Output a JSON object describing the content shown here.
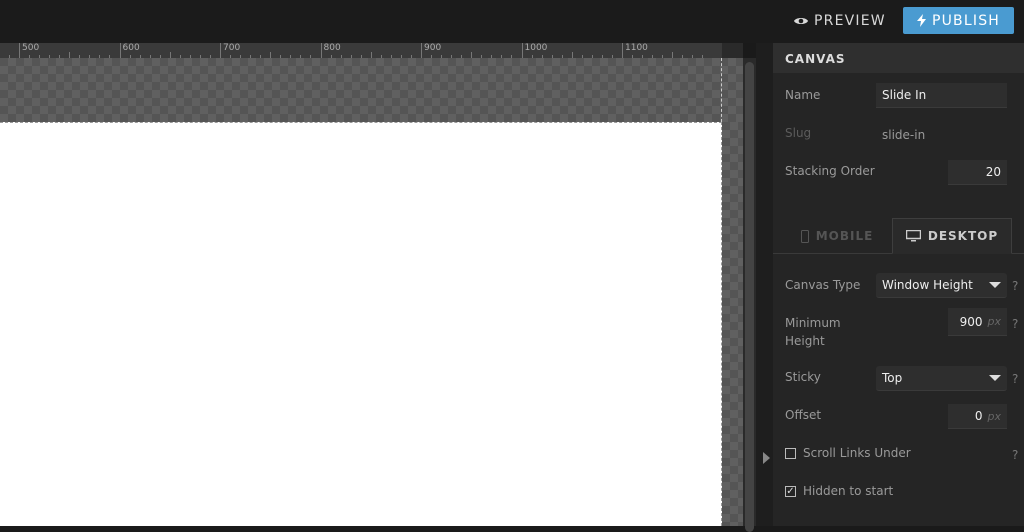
{
  "topbar": {
    "preview_label": "PREVIEW",
    "publish_label": "PUBLISH",
    "accent": "#4a9bd1"
  },
  "ruler": {
    "labels": [
      "500",
      "600",
      "700",
      "800",
      "900",
      "1000",
      "1100"
    ]
  },
  "panel": {
    "title": "CANVAS",
    "name_label": "Name",
    "name_value": "Slide In",
    "slug_label": "Slug",
    "slug_value": "slide-in",
    "stacking_label": "Stacking Order",
    "stacking_value": "20",
    "tabs": {
      "mobile": "MOBILE",
      "desktop": "DESKTOP",
      "active": "desktop"
    },
    "canvas_type_label": "Canvas Type",
    "canvas_type_value": "Window Height",
    "min_height_label": "Minimum Height",
    "min_height_value": "900",
    "unit": "px",
    "sticky_label": "Sticky",
    "sticky_value": "Top",
    "offset_label": "Offset",
    "offset_value": "0",
    "scroll_links_label": "Scroll Links Under",
    "scroll_links_checked": false,
    "hidden_label": "Hidden to start",
    "hidden_checked": true,
    "help": "?"
  }
}
